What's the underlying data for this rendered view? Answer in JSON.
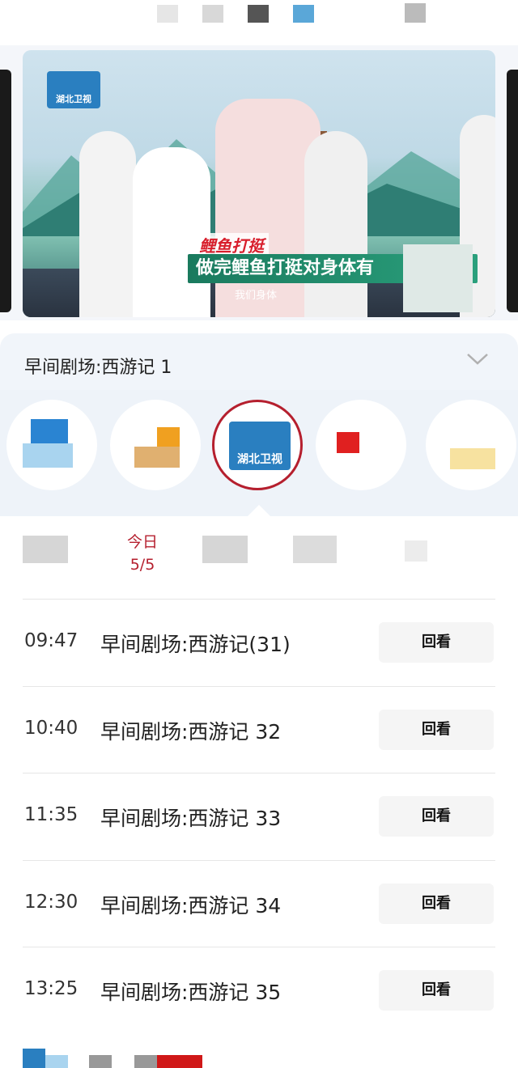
{
  "video": {
    "channel_logo_text": "湖北卫视",
    "caption_title": "鲤鱼打挺",
    "caption_main": "做完鲤鱼打挺对身体有",
    "caption_sub": "我们身体"
  },
  "program": {
    "current_title": "早间剧场:西游记 1"
  },
  "channels": {
    "active_logo_text": "湖北卫视"
  },
  "dates": {
    "today_label": "今日",
    "today_date": "5/5"
  },
  "schedule": [
    {
      "time": "09:47",
      "title": "早间剧场:西游记(31)",
      "action": "回看"
    },
    {
      "time": "10:40",
      "title": "早间剧场:西游记 32",
      "action": "回看"
    },
    {
      "time": "11:35",
      "title": "早间剧场:西游记 33",
      "action": "回看"
    },
    {
      "time": "12:30",
      "title": "早间剧场:西游记 34",
      "action": "回看"
    },
    {
      "time": "13:25",
      "title": "早间剧场:西游记 35",
      "action": "回看"
    }
  ],
  "colors": {
    "accent": "#b51f2e",
    "background": "#ffffff",
    "panel": "#f1f5fa",
    "replay_button": "#f5f5f5"
  },
  "icons": {
    "expand": "chevron-down-icon"
  }
}
